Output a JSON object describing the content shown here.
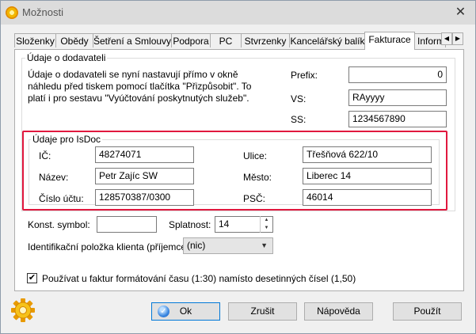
{
  "window": {
    "title": "Možnosti",
    "close_glyph": "✕"
  },
  "tabs": [
    {
      "label": "Složenky",
      "active": false
    },
    {
      "label": "Obědy",
      "active": false
    },
    {
      "label": "Šetření a Smlouvy",
      "active": false
    },
    {
      "label": "Podpora",
      "active": false
    },
    {
      "label": "PC",
      "active": false
    },
    {
      "label": "Stvrzenky",
      "active": false
    },
    {
      "label": "Kancelářský balík",
      "active": false
    },
    {
      "label": "Fakturace",
      "active": true
    },
    {
      "label": "Inform",
      "active": false
    }
  ],
  "supplier": {
    "group_label": "Údaje o dodavateli",
    "note": "Údaje o dodavateli se nyní nastavují přímo v okně náhledu před tiskem pomocí tlačítka \"Přizpůsobit\". To platí i pro sestavu \"Vyúčtování poskytnutých služeb\".",
    "prefix_label": "Prefix:",
    "prefix_value": "0",
    "vs_label": "VS:",
    "vs_value": "RAyyyy",
    "ss_label": "SS:",
    "ss_value": "1234567890"
  },
  "isdoc": {
    "group_label": "Údaje pro IsDoc",
    "ic_label": "IČ:",
    "ic_value": "48274071",
    "name_label": "Název:",
    "name_value": "Petr Zajíc SW",
    "account_label": "Číslo účtu:",
    "account_value": "128570387/0300",
    "street_label": "Ulice:",
    "street_value": "Třešňová 622/10",
    "city_label": "Město:",
    "city_value": "Liberec 14",
    "zip_label": "PSČ:",
    "zip_value": "46014"
  },
  "misc": {
    "const_symbol_label": "Konst. symbol:",
    "const_symbol_value": "",
    "due_label": "Splatnost:",
    "due_value": "14",
    "client_id_label": "Identifikační položka klienta (příjemce):",
    "client_id_value": "(nic)",
    "time_format_label": "Používat u faktur formátování času (1:30) namísto desetinných čísel (1,50)",
    "time_format_checked": true
  },
  "buttons": {
    "ok": "Ok",
    "cancel": "Zrušit",
    "help": "Nápověda",
    "apply": "Použít"
  },
  "colors": {
    "highlight": "#e1183e",
    "default_button_border": "#0078d7"
  }
}
